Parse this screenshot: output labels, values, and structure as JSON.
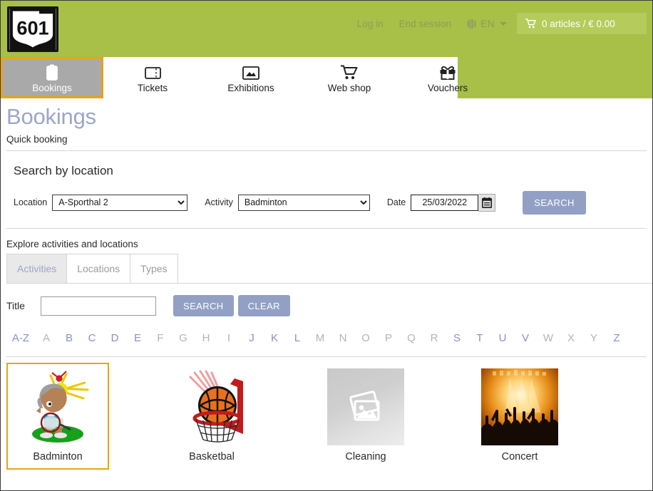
{
  "header": {
    "logo_text": "601",
    "login_label": "Log in",
    "end_session_label": "End session",
    "language": "EN",
    "cart_label": "0 articles / € 0.00",
    "bg_color": "#a8bf48"
  },
  "nav": {
    "items": [
      {
        "label": "Bookings",
        "icon": "clipboard-icon",
        "active": true
      },
      {
        "label": "Tickets",
        "icon": "ticket-icon",
        "active": false
      },
      {
        "label": "Exhibitions",
        "icon": "picture-frame-icon",
        "active": false
      },
      {
        "label": "Web shop",
        "icon": "shopping-cart-icon",
        "active": false
      },
      {
        "label": "Vouchers",
        "icon": "gift-icon",
        "active": false
      }
    ],
    "active_outline_color": "#e8a317"
  },
  "page": {
    "title": "Bookings",
    "breadcrumb": "Quick booking",
    "title_color": "#9ba6c9"
  },
  "search_by_location": {
    "heading": "Search by location",
    "location_label": "Location",
    "location_value": "A-Sporthal 2",
    "location_options": [
      "A-Sporthal 2"
    ],
    "activity_label": "Activity",
    "activity_value": "Badminton",
    "activity_options": [
      "Badminton"
    ],
    "date_label": "Date",
    "date_value": "25/03/2022",
    "calendar_icon": "calendar-icon",
    "search_button": "SEARCH",
    "button_color": "#92a0c6"
  },
  "explore": {
    "label": "Explore activities and locations",
    "tabs": [
      {
        "label": "Activities",
        "active": true
      },
      {
        "label": "Locations",
        "active": false
      },
      {
        "label": "Types",
        "active": false
      }
    ],
    "title_label": "Title",
    "title_value": "",
    "title_placeholder": "",
    "search_button": "SEARCH",
    "clear_button": "CLEAR",
    "alphabet": [
      {
        "label": "A-Z",
        "enabled": true
      },
      {
        "label": "A",
        "enabled": false
      },
      {
        "label": "B",
        "enabled": true
      },
      {
        "label": "C",
        "enabled": true
      },
      {
        "label": "D",
        "enabled": true
      },
      {
        "label": "E",
        "enabled": true
      },
      {
        "label": "F",
        "enabled": false
      },
      {
        "label": "G",
        "enabled": false
      },
      {
        "label": "H",
        "enabled": false
      },
      {
        "label": "I",
        "enabled": false
      },
      {
        "label": "J",
        "enabled": true
      },
      {
        "label": "K",
        "enabled": true
      },
      {
        "label": "L",
        "enabled": true
      },
      {
        "label": "M",
        "enabled": false
      },
      {
        "label": "N",
        "enabled": false
      },
      {
        "label": "O",
        "enabled": false
      },
      {
        "label": "P",
        "enabled": false
      },
      {
        "label": "Q",
        "enabled": false
      },
      {
        "label": "R",
        "enabled": false
      },
      {
        "label": "S",
        "enabled": true
      },
      {
        "label": "T",
        "enabled": true
      },
      {
        "label": "U",
        "enabled": true
      },
      {
        "label": "V",
        "enabled": true
      },
      {
        "label": "W",
        "enabled": false
      },
      {
        "label": "X",
        "enabled": false
      },
      {
        "label": "Y",
        "enabled": false
      },
      {
        "label": "Z",
        "enabled": true
      }
    ],
    "cards": [
      {
        "label": "Badminton",
        "image": "badminton-cartoon-image",
        "selected": true
      },
      {
        "label": "Basketbal",
        "image": "basketball-hoop-image",
        "selected": false
      },
      {
        "label": "Cleaning",
        "image": "placeholder-image-icon",
        "selected": false
      },
      {
        "label": "Concert",
        "image": "concert-crowd-image",
        "selected": false
      }
    ]
  }
}
